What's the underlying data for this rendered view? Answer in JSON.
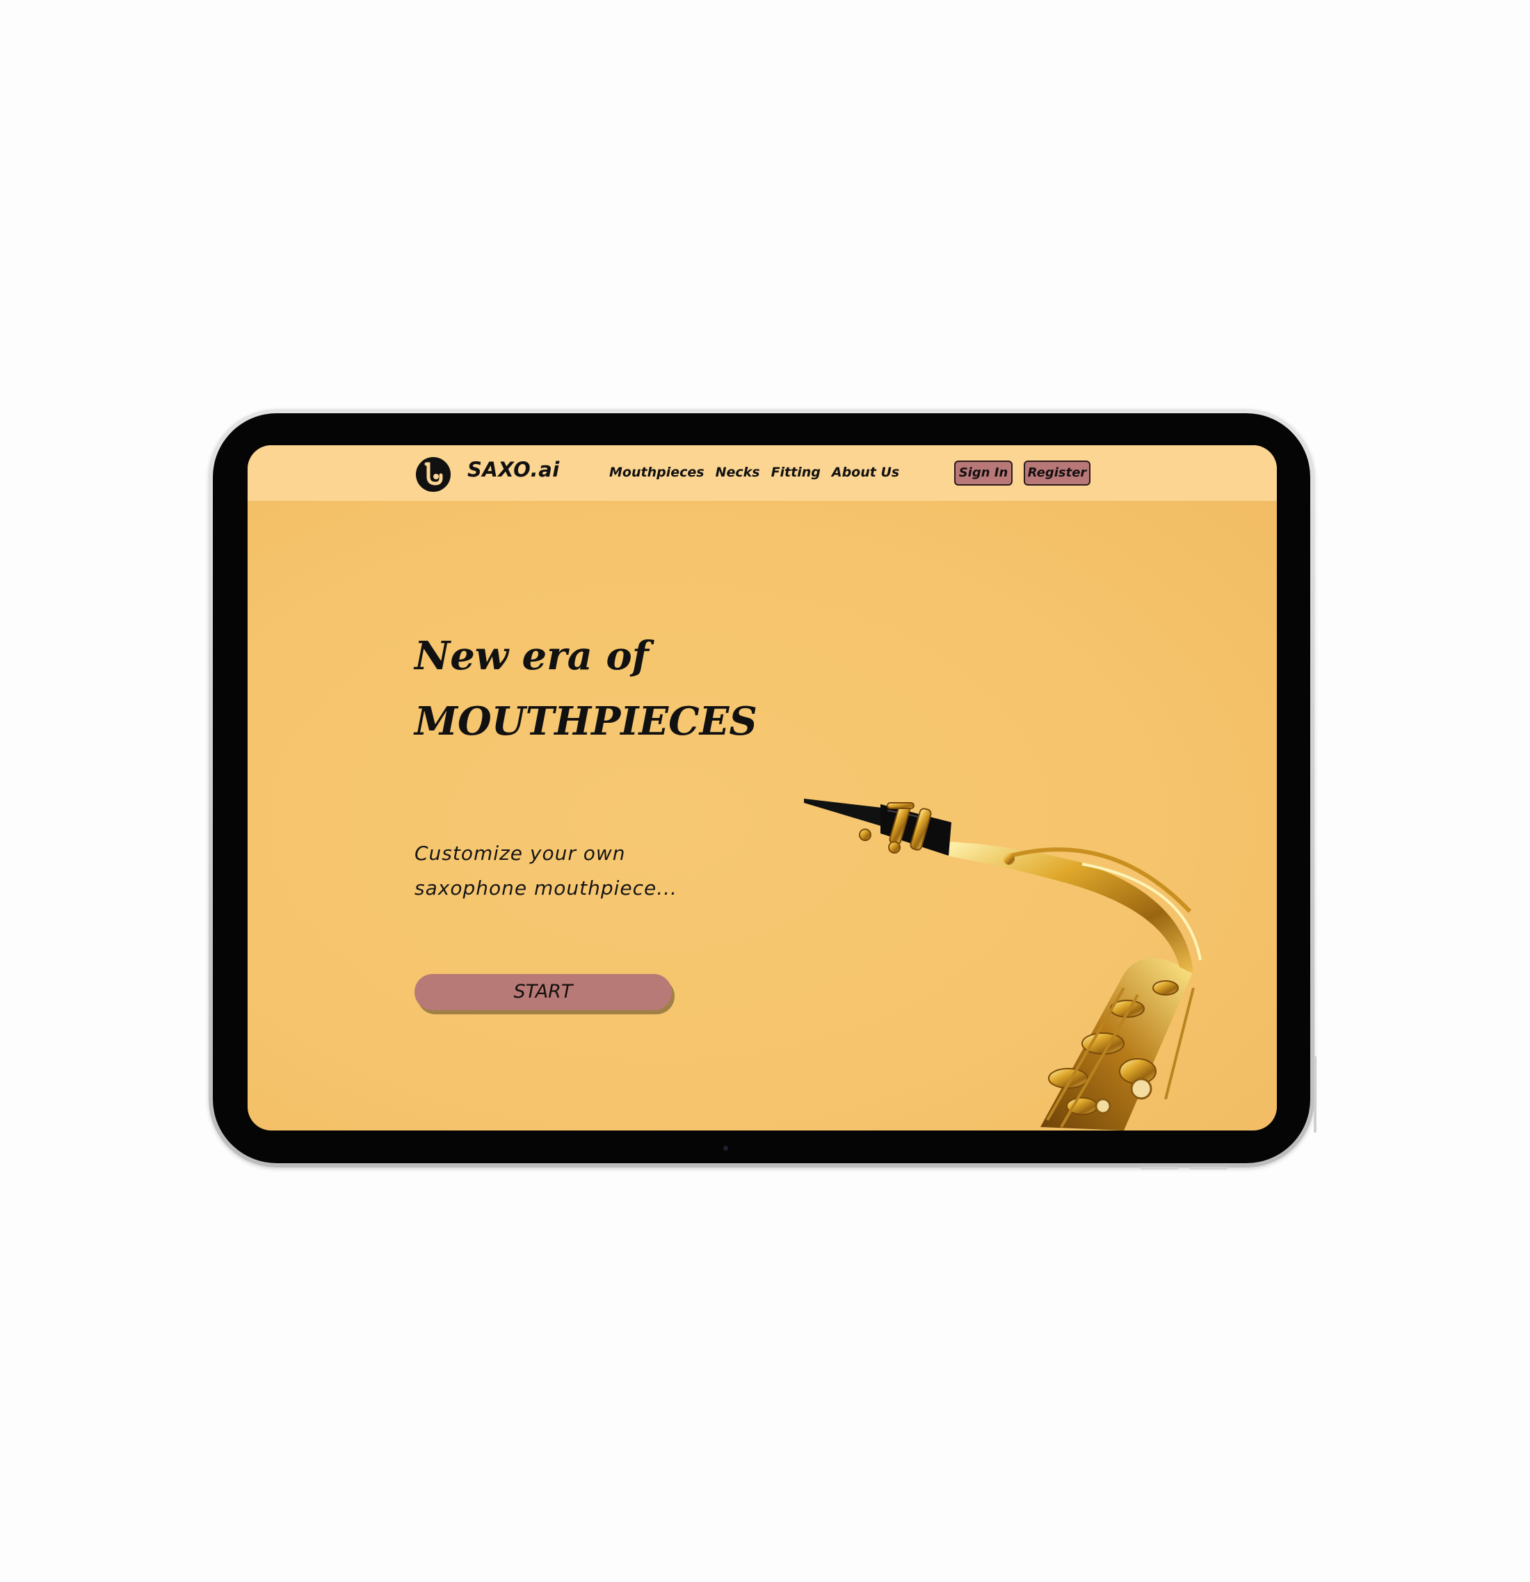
{
  "brand": {
    "name": "SAXO.ai",
    "logo_icon": "saxophone-logo-icon"
  },
  "nav": {
    "links": [
      "Mouthpieces",
      "Necks",
      "Fitting",
      "About Us"
    ],
    "signin_label": "Sign In",
    "register_label": "Register"
  },
  "hero": {
    "title_line1": "New era of",
    "title_line2": "MOUTHPIECES",
    "subtitle_line1": "Customize your own",
    "subtitle_line2": "saxophone mouthpiece...",
    "cta_label": "START",
    "image": "saxophone-neck-image"
  },
  "colors": {
    "background": "#f5c46c",
    "navbar": "#fbd591",
    "button": "#b87878",
    "text": "#111111"
  }
}
